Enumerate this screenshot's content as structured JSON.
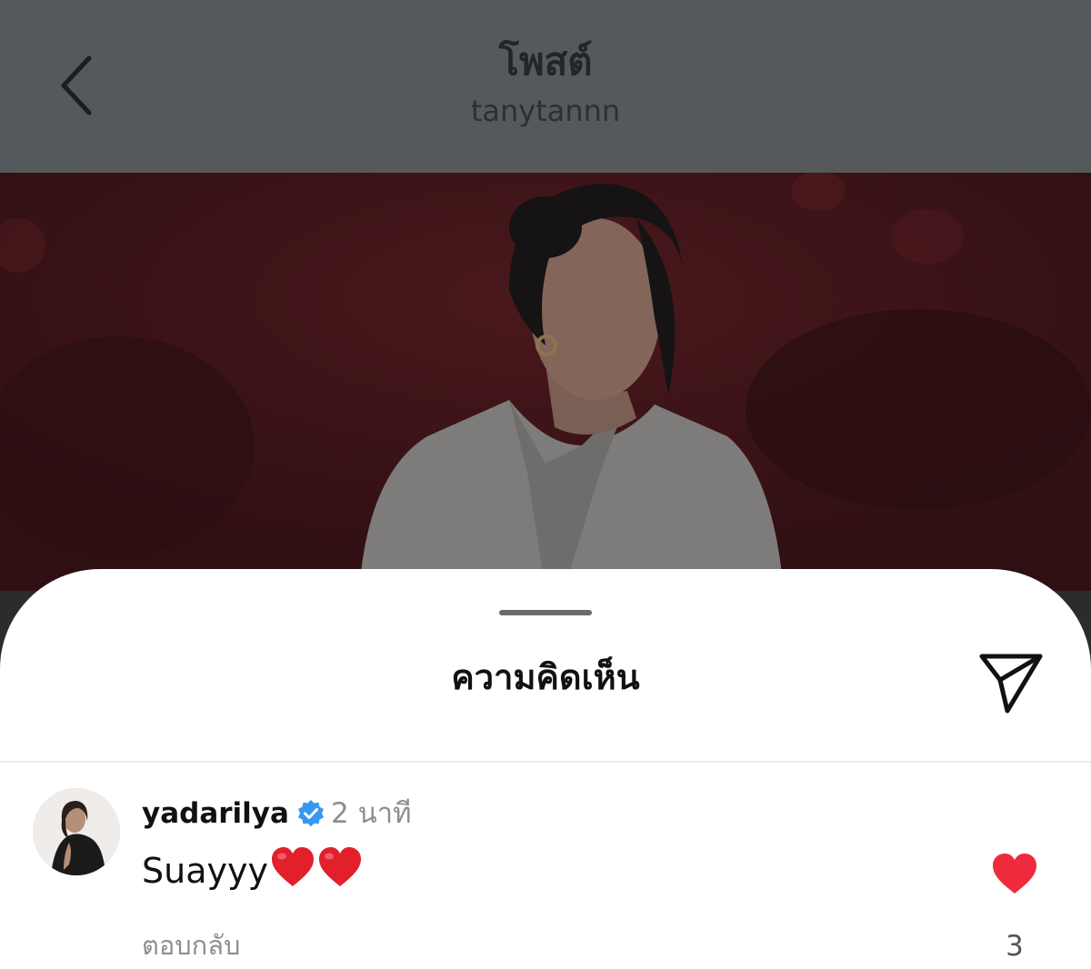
{
  "header": {
    "title": "โพสต์",
    "subtitle": "tanytannn",
    "back_icon": "chevron-left-icon"
  },
  "photo": {
    "background_color": "#3d1417"
  },
  "comments_sheet": {
    "title": "ความคิดเห็น",
    "share_icon": "paper-plane-icon",
    "comments": [
      {
        "username": "yadarilya",
        "verified": true,
        "timestamp": "2 นาที",
        "text": "Suayyy",
        "emoji": [
          "red-heart",
          "red-heart"
        ],
        "reply_label": "ตอบกลับ",
        "liked": true,
        "like_count": "3"
      }
    ]
  },
  "colors": {
    "like_red": "#ed2b3c",
    "verified_blue": "#3897f0",
    "secondary_text": "#8e8e8e",
    "overlay_header": "#56595c"
  }
}
